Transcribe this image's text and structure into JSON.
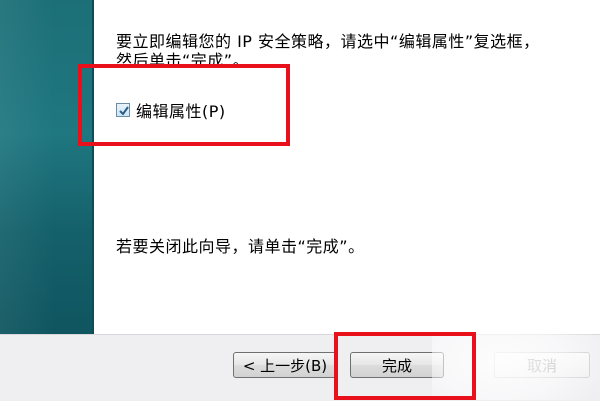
{
  "wizard": {
    "intro_text": "要立即编辑您的 IP 安全策略，请选中“编辑属性”复选框，然后单击“完成”。",
    "checkbox_label": "编辑属性(P)",
    "checkbox_checked": true,
    "close_text": "若要关闭此向导，请单击“完成”。"
  },
  "buttons": {
    "back_label": "< 上一步(B)",
    "finish_label": "完成",
    "cancel_label": "取消"
  },
  "colors": {
    "banner": "#1f7780",
    "highlight": "#e8101a"
  }
}
